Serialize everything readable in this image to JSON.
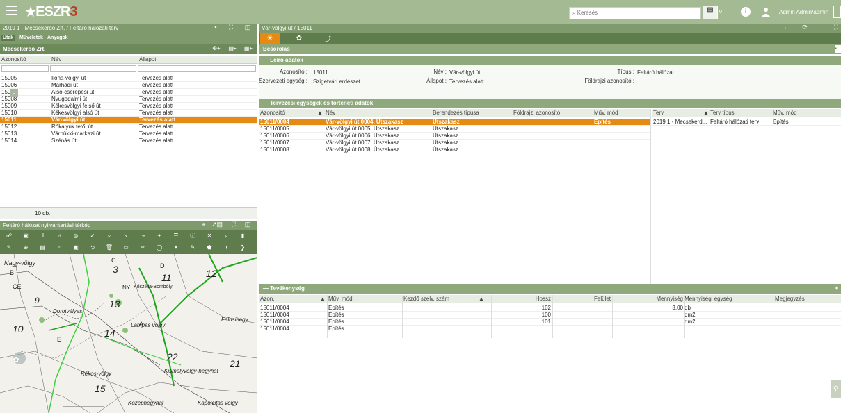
{
  "app": {
    "logo": "ESZR",
    "logo_badge": "3",
    "search_placeholder": "Keresés",
    "print_count": "0",
    "user": "Admin Admin/admin"
  },
  "left": {
    "title": "2019 1 - Mecsekerdő Zrt. / Feltáró hálózati terv",
    "tabs": [
      "Utak",
      "Műveletek",
      "Anyagok"
    ],
    "org": "Mecsekerdő Zrt.",
    "columns": [
      "Azonosító",
      "Név",
      "Állapot"
    ],
    "rows": [
      {
        "id": "15005",
        "name": "Ilona-völgyi út",
        "state": "Tervezés alatt"
      },
      {
        "id": "15006",
        "name": "Marhádi út",
        "state": "Tervezés alatt"
      },
      {
        "id": "15007",
        "name": "Alsó-cserepesi út",
        "state": "Tervezés alatt"
      },
      {
        "id": "15008",
        "name": "Nyugodalmi út",
        "state": "Tervezés alatt"
      },
      {
        "id": "15009",
        "name": "Kékesvölgyi felső út",
        "state": "Tervezés alatt"
      },
      {
        "id": "15010",
        "name": "Kékesvölgyi alsó út",
        "state": "Tervezés alatt"
      },
      {
        "id": "15011",
        "name": "Vár-völgyi út",
        "state": "Tervezés alatt",
        "selected": true
      },
      {
        "id": "15012",
        "name": "Rókalyuk tetői út",
        "state": "Tervezés alatt"
      },
      {
        "id": "15013",
        "name": "Várbükki-markazi út",
        "state": "Tervezés alatt"
      },
      {
        "id": "15014",
        "name": "Szénás út",
        "state": "Tervezés alatt"
      }
    ],
    "count": "10 db.",
    "map_title": "Feltáró hálózat nyilvántartási térkép",
    "map_labels": [
      "Nagy-völgy",
      "B",
      "CE",
      "C",
      "3",
      "D",
      "11",
      "12",
      "13",
      "14",
      "9",
      "10",
      "15",
      "22",
      "21",
      "A",
      "E",
      "NY",
      "Kismelyvölgy-hegyhát",
      "Lampás völgy",
      "Falusihegy",
      "Kapolcitás völgy",
      "Rékos-völgy",
      "Középhegyhát",
      "Dorotvélyes",
      "Kőszikla-Bombólyi"
    ]
  },
  "right": {
    "title": "Vár-völgyi út / 15011",
    "section_besorolas": "Besorolás",
    "section_leiro": "Leíró adatok",
    "fields": {
      "azonosito_label": "Azonosító :",
      "azonosito": "15011",
      "nev_label": "Név :",
      "nev": "Vár-völgyi út",
      "tipus_label": "Típus :",
      "tipus": "Feltáró hálózat",
      "szerv_label": "Szervezeti egység :",
      "szerv": "Szigetvári erdészet",
      "allapot_label": "Állapot :",
      "allapot": "Tervezés alatt",
      "foldrajzi_label": "Földrajzi azonosító :"
    },
    "section_tervezesi": "Tervezési egységek és történeti adatok",
    "units_columns": [
      "Azonosító",
      "Név",
      "Berendezés típusa",
      "Földrajzi azonosító",
      "Műv. mód"
    ],
    "units_rows": [
      {
        "id": "15011/0004",
        "name": "Vár-völgyi út 0004. Útszakasz",
        "type": "Útszakasz",
        "geo": "",
        "mode": "Építés",
        "selected": true
      },
      {
        "id": "15011/0005",
        "name": "Vár-völgyi út 0005. Útszakasz",
        "type": "Útszakasz",
        "geo": "",
        "mode": ""
      },
      {
        "id": "15011/0006",
        "name": "Vár-völgyi út 0006. Útszakasz",
        "type": "Útszakasz",
        "geo": "",
        "mode": ""
      },
      {
        "id": "15011/0007",
        "name": "Vár-völgyi út 0007. Útszakasz",
        "type": "Útszakasz",
        "geo": "",
        "mode": ""
      },
      {
        "id": "15011/0008",
        "name": "Vár-völgyi út 0008. Útszakasz",
        "type": "Útszakasz",
        "geo": "",
        "mode": ""
      }
    ],
    "plan_columns": [
      "Terv",
      "Terv típus",
      "Műv. mód"
    ],
    "plan_rows": [
      {
        "terv": "2019 1 - Mecsekerd...",
        "tipus": "Feltáró hálózati terv",
        "mode": "Építés"
      }
    ],
    "section_tevekenyseg": "Tevékenység",
    "act_columns": [
      "Azon.",
      "Műv. mód",
      "Kezdő szelv. szám",
      "Hossz",
      "Felület",
      "Mennyiség",
      "Mennyiségi egység",
      "Megjegyzés"
    ],
    "act_sort": [
      "1",
      "2"
    ],
    "act_rows": [
      {
        "azon": "15011/0004",
        "mode": "Építés",
        "kezdo": "",
        "hossz": "102",
        "felulet": "",
        "menny": "3.00",
        "egyseg": "db",
        "megj": ""
      },
      {
        "azon": "15011/0004",
        "mode": "Építés",
        "kezdo": "",
        "hossz": "100",
        "felulet": "",
        "menny": "",
        "egyseg": "dm2",
        "megj": ""
      },
      {
        "azon": "15011/0004",
        "mode": "Építés",
        "kezdo": "",
        "hossz": "101",
        "felulet": "",
        "menny": "",
        "egyseg": "dm2",
        "megj": ""
      },
      {
        "azon": "15011/0004",
        "mode": "Építés",
        "kezdo": "",
        "hossz": "",
        "felulet": "",
        "menny": "",
        "egyseg": "",
        "megj": ""
      }
    ]
  },
  "colors": {
    "topbar": "#a4ba93",
    "header": "#7f9a6d",
    "selected": "#e58a12",
    "toolbar": "#5f7c4c"
  }
}
